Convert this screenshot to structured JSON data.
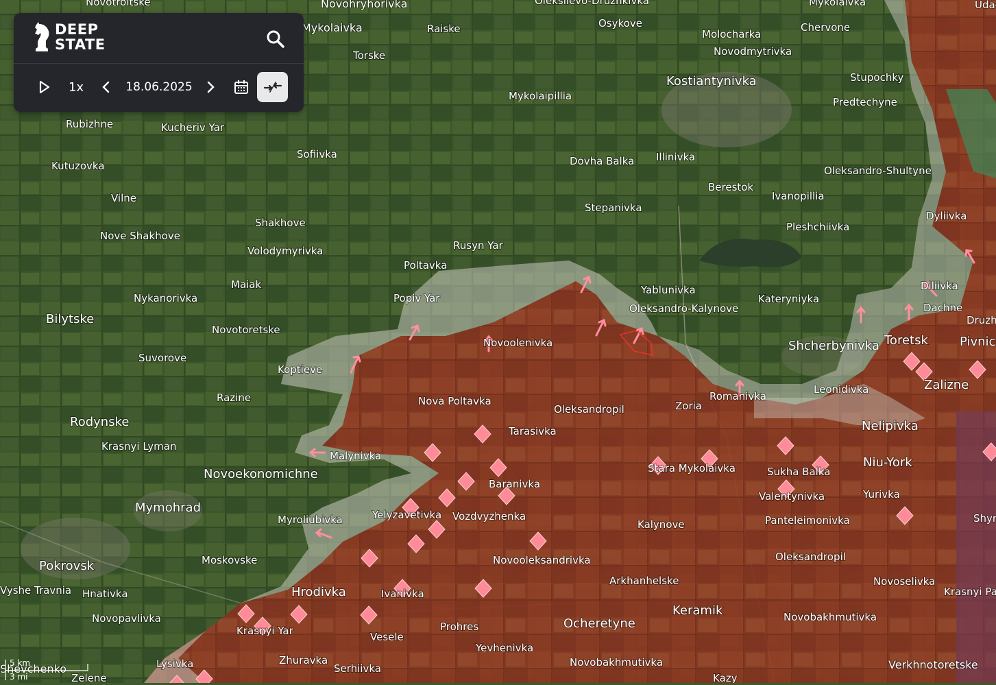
{
  "toolbar": {
    "logo_line1": "DEEP",
    "logo_line2": "STATE",
    "speed": "1x",
    "date": "18.06.2025"
  },
  "scale": {
    "km": "5 km",
    "mi": "3 mi"
  },
  "colors": {
    "occupied": "#8a2c1a",
    "contested": "#c9c9c0",
    "attack_arrow": "#ff7a8a",
    "fortification": "#ff7a8a"
  },
  "places": [
    "Novotroitske",
    "Novohryhorivka",
    "Oleksiievo-Druzhkivka",
    "Mykolaivka",
    "Udachne",
    "Mykolaivka",
    "Raiske",
    "Osykove",
    "Molocharka",
    "Chervone",
    "Torske",
    "Novodmytrivka",
    "Kostiantynivka",
    "Stupochky",
    "Mykolaipillia",
    "Predtechyne",
    "Rubizhne",
    "Kucheriv Yar",
    "Sofiivka",
    "Dovha Balka",
    "Illinivka",
    "Kutuzovka",
    "Oleksandro-Shultyne",
    "Berestok",
    "Ivanopillia",
    "Vilne",
    "Stepanivka",
    "Dyliivka",
    "Shakhove",
    "Pleshchiivka",
    "Nove Shakhove",
    "Rusyn Yar",
    "Volodymyrivka",
    "Poltavka",
    "Maiak",
    "Yablunivka",
    "Diliivka",
    "Dachne",
    "Popiv Yar",
    "Kateryniyka",
    "Oleksandro-Kalynove",
    "Nykanorivka",
    "Druzh",
    "Bilytske",
    "Novotoretske",
    "Toretsk",
    "Pivnich",
    "Novoolenivka",
    "Shcherbynivka",
    "Suvorove",
    "Koptieve",
    "Leonidivka",
    "Zalizne",
    "Razine",
    "Nova Poltavka",
    "Romanivka",
    "Oleksandropil",
    "Zoria",
    "Rodynske",
    "Nelipivka",
    "Tarasivka",
    "Krasnyi Lyman",
    "Malynivka",
    "Stara Mykolaivka",
    "Novoekonomichne",
    "Sukha Balka",
    "Niu-York",
    "Baranivka",
    "Mymohrad",
    "Valentynivka",
    "Yurivka",
    "Yelyzavetivka",
    "Vozdvyzhenka",
    "Panteleimonivka",
    "Shyn",
    "Myroliubivka",
    "Kalynove",
    "Moskovske",
    "Oleksandropil",
    "Novooleksandrivka",
    "Pokrovsk",
    "Arkhanhelske",
    "Novoselivka",
    "Krasnyi Pa",
    "Vyshe Travnia",
    "Hnativka",
    "Hrodivka",
    "Ivanivka",
    "Keramik",
    "Novopavlivka",
    "Novobakhmutivka",
    "Krasnyi Yar",
    "Vesele",
    "Prohres",
    "Ocheretyne",
    "Yevhenivka",
    "Lysivka",
    "Zhuravka",
    "Serhiivka",
    "Novobakhmutivka",
    "Verkhnotoretske",
    "Zelene",
    "Shevchenko",
    "Kazy"
  ]
}
